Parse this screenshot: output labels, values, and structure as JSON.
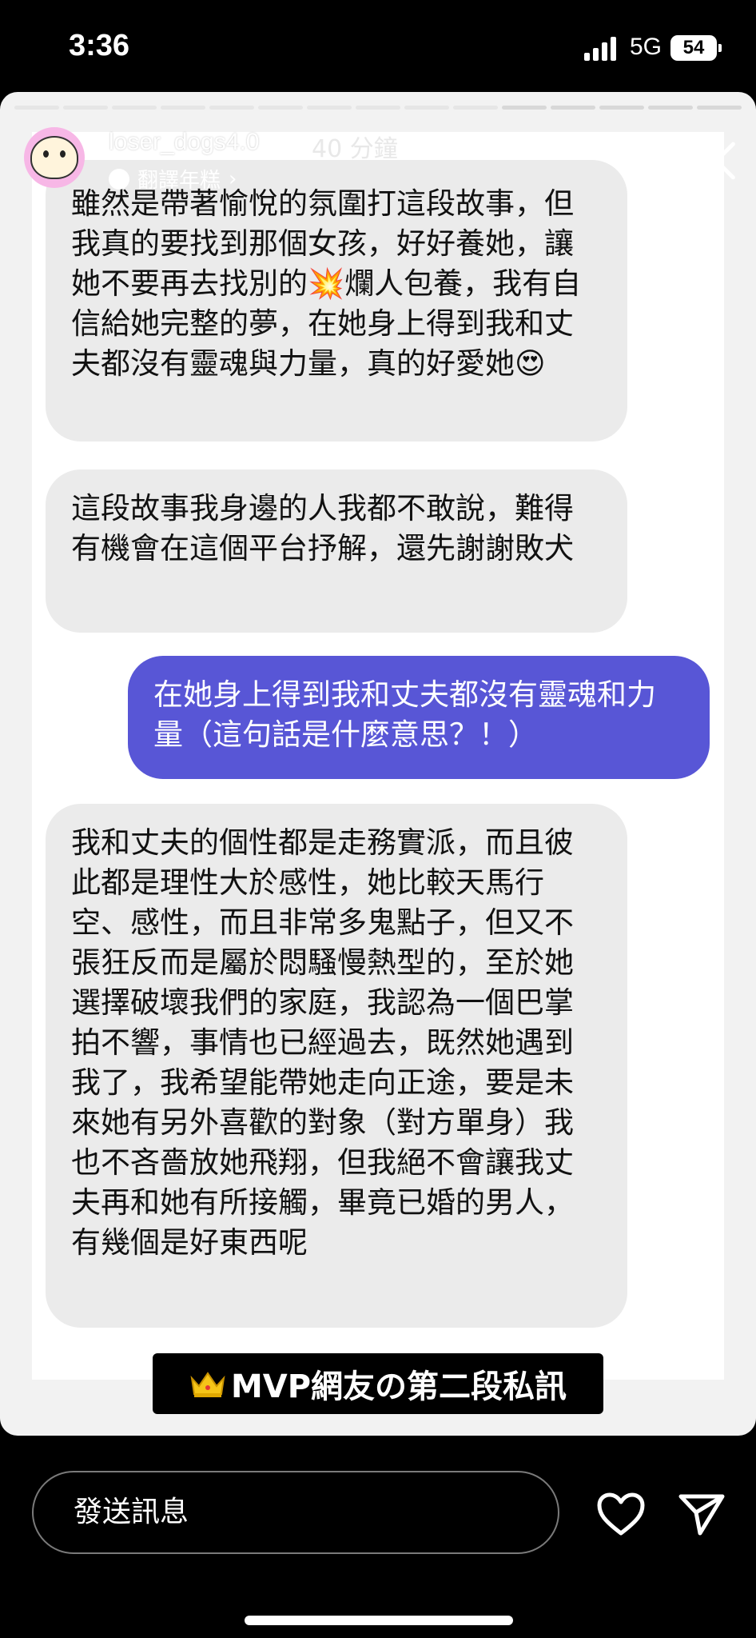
{
  "status_bar": {
    "time": "3:36",
    "network": "5G",
    "battery": "54"
  },
  "story": {
    "username": "loser_dogs4.0",
    "time_ago": "40 分鐘",
    "translate_label": "翻譯年糕",
    "more_label": "•••",
    "progress_segments": 15,
    "progress_done": 10
  },
  "messages": [
    {
      "direction": "incoming",
      "text": "雖然是帶著愉悅的氛圍打這段故事，但我真的要找到那個女孩，好好養她，讓她不要再去找別的💥爛人包養，我有自信給她完整的夢，在她身上得到我和丈夫都沒有靈魂與力量，真的好愛她😍"
    },
    {
      "direction": "incoming",
      "text": "這段故事我身邊的人我都不敢說，難得有機會在這個平台抒解，還先謝謝敗犬"
    },
    {
      "direction": "outgoing",
      "text": "在她身上得到我和丈夫都沒有靈魂和力量（這句話是什麼意思？！）"
    },
    {
      "direction": "incoming",
      "text": "我和丈夫的個性都是走務實派，而且彼此都是理性大於感性，她比較天馬行空、感性，而且非常多鬼點子，但又不張狂反而是屬於悶騷慢熱型的，至於她選擇破壞我們的家庭，我認為一個巴掌拍不響，事情也已經過去，既然她遇到我了，我希望能帶她走向正途，要是未來她有另外喜歡的對象（對方單身）我也不吝嗇放她飛翔，但我絕不會讓我丈夫再和她有所接觸，畢竟已婚的男人，有幾個是好東西呢"
    }
  ],
  "caption": {
    "text": "MVP網友の第二段私訊",
    "icon": "crown-icon"
  },
  "bottom_bar": {
    "message_placeholder": "發送訊息",
    "like_icon": "heart-icon",
    "share_icon": "send-icon"
  },
  "colors": {
    "outgoing_bubble": "#5856d6",
    "incoming_bubble": "#ebebeb",
    "background": "#000000"
  }
}
